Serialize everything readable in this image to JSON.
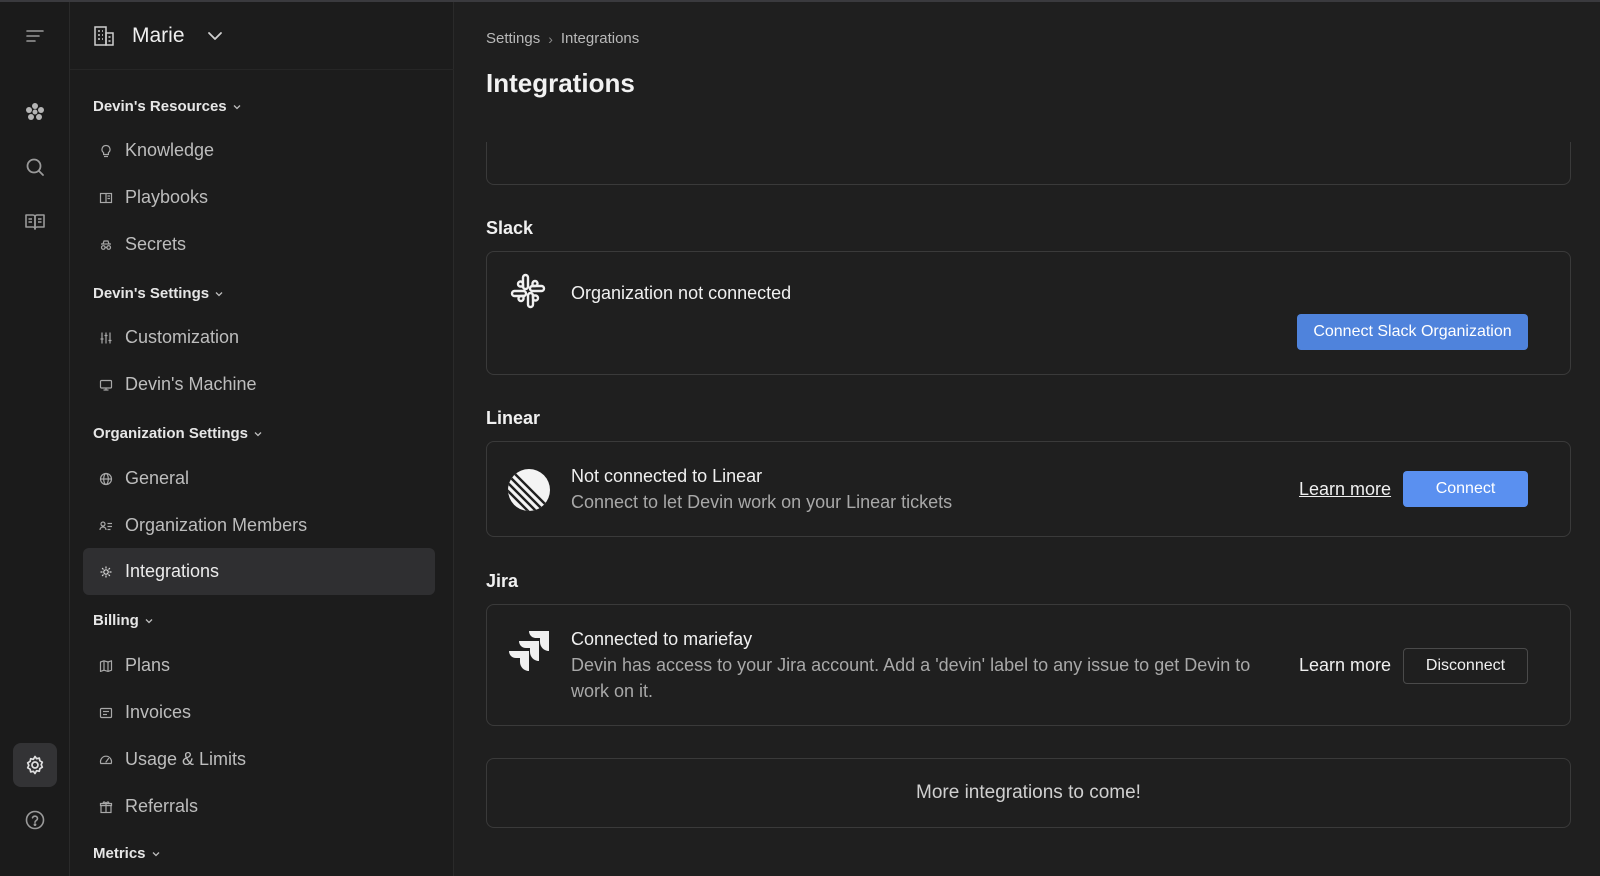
{
  "workspace": {
    "name": "Marie"
  },
  "sidebar": {
    "sections": [
      {
        "label": "Devin's Resources",
        "items": [
          {
            "label": "Knowledge",
            "icon": "lightbulb-icon"
          },
          {
            "label": "Playbooks",
            "icon": "book-icon"
          },
          {
            "label": "Secrets",
            "icon": "incognito-icon"
          }
        ]
      },
      {
        "label": "Devin's Settings",
        "items": [
          {
            "label": "Customization",
            "icon": "sliders-icon"
          },
          {
            "label": "Devin's Machine",
            "icon": "monitor-icon"
          }
        ]
      },
      {
        "label": "Organization Settings",
        "items": [
          {
            "label": "General",
            "icon": "globe-icon"
          },
          {
            "label": "Organization Members",
            "icon": "members-icon"
          },
          {
            "label": "Integrations",
            "icon": "plug-icon",
            "active": true
          }
        ]
      },
      {
        "label": "Billing",
        "items": [
          {
            "label": "Plans",
            "icon": "map-icon"
          },
          {
            "label": "Invoices",
            "icon": "receipt-icon"
          },
          {
            "label": "Usage & Limits",
            "icon": "gauge-icon"
          },
          {
            "label": "Referrals",
            "icon": "gift-icon"
          }
        ]
      },
      {
        "label": "Metrics",
        "items": []
      }
    ]
  },
  "breadcrumb": {
    "parent": "Settings",
    "current": "Integrations"
  },
  "page": {
    "title": "Integrations"
  },
  "integrations": {
    "slack": {
      "heading": "Slack",
      "status": "Organization not connected",
      "button": "Connect Slack Organization"
    },
    "linear": {
      "heading": "Linear",
      "status": "Not connected to Linear",
      "description": "Connect to let Devin work on your Linear tickets",
      "learn_more": "Learn more",
      "button": "Connect"
    },
    "jira": {
      "heading": "Jira",
      "status": "Connected to mariefay",
      "description": "Devin has access to your Jira account. Add a 'devin' label to any issue to get Devin to work on it.",
      "learn_more": "Learn more",
      "button": "Disconnect"
    },
    "more": "More integrations to come!"
  },
  "colors": {
    "background": "#1f1f1f",
    "sidebar": "#1c1c1c",
    "accent": "#4f83dc",
    "accent_bright": "#5a90f0",
    "card_border": "#3a3a3a"
  }
}
